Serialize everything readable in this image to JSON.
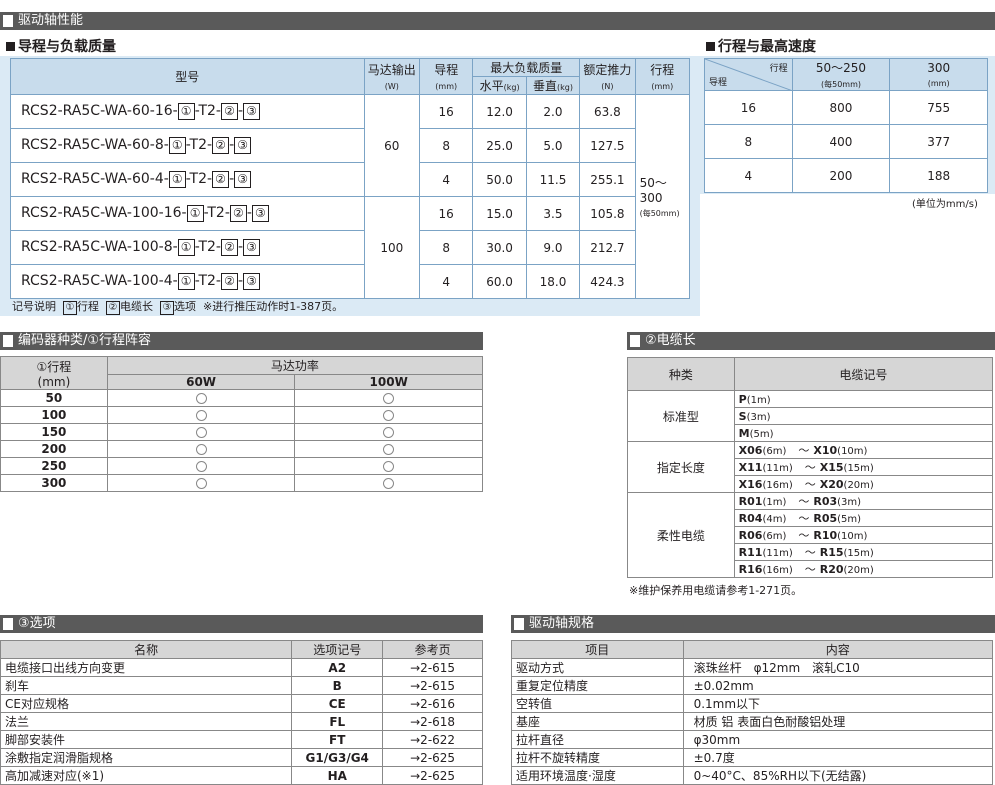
{
  "banner_top": "驱动轴性能",
  "section_lead": "导程与负载质量",
  "section_speed": "行程与最高速度",
  "lead_table": {
    "h_model": "型号",
    "h_motor": "马达输出",
    "h_motor_unit": "(W)",
    "h_lead": "导程",
    "h_lead_unit": "(mm)",
    "h_load": "最大负载质量",
    "h_horiz": "水平",
    "h_vert": "垂直",
    "h_kg": "(kg)",
    "h_thrust": "额定推力",
    "h_thrust_unit": "(N)",
    "h_stroke": "行程",
    "h_stroke_unit": "(mm)",
    "stroke": "50～300",
    "stroke_note": "(每50mm)",
    "motor_60": "60",
    "motor_100": "100",
    "code_1": "①",
    "code_2": "②",
    "code_3": "③",
    "code_t2": "-T2-",
    "rows": [
      {
        "model": "RCS2-RA5C-WA-60-16-",
        "lead": "16",
        "h": "12.0",
        "v": "2.0",
        "f": "63.8"
      },
      {
        "model": "RCS2-RA5C-WA-60-8-",
        "lead": "8",
        "h": "25.0",
        "v": "5.0",
        "f": "127.5"
      },
      {
        "model": "RCS2-RA5C-WA-60-4-",
        "lead": "4",
        "h": "50.0",
        "v": "11.5",
        "f": "255.1"
      },
      {
        "model": "RCS2-RA5C-WA-100-16-",
        "lead": "16",
        "h": "15.0",
        "v": "3.5",
        "f": "105.8"
      },
      {
        "model": "RCS2-RA5C-WA-100-8-",
        "lead": "8",
        "h": "30.0",
        "v": "9.0",
        "f": "212.7"
      },
      {
        "model": "RCS2-RA5C-WA-100-4-",
        "lead": "4",
        "h": "60.0",
        "v": "18.0",
        "f": "424.3"
      }
    ]
  },
  "legend": {
    "label": "记号说明",
    "i1": "行程",
    "i2": "电缆长",
    "i3": "选项",
    "note": "※进行推压动作时1-387页。"
  },
  "speed_table": {
    "h_stroke": "行程",
    "h_lead": "导程",
    "h_col1": "50～250",
    "h_col1_note": "(每50mm)",
    "h_col2": "300",
    "h_col2_note": "(mm)",
    "rows": [
      {
        "lead": "16",
        "a": "800",
        "b": "755"
      },
      {
        "lead": "8",
        "a": "400",
        "b": "377"
      },
      {
        "lead": "4",
        "a": "200",
        "b": "188"
      }
    ],
    "unit": "(单位为mm/s)"
  },
  "encoder": {
    "banner": "编码器种类/①行程阵容",
    "h_stroke": "①行程",
    "h_stroke_unit": "(mm)",
    "h_power": "马达功率",
    "h_60": "60W",
    "h_100": "100W",
    "rows": [
      "50",
      "100",
      "150",
      "200",
      "250",
      "300"
    ]
  },
  "cable": {
    "banner": "②电缆长",
    "h_type": "种类",
    "h_code": "电缆记号",
    "standard": "标准型",
    "specified": "指定长度",
    "flex": "柔性电缆",
    "tilde": "～",
    "std_rows": [
      {
        "c": "P",
        "l": "(1m)"
      },
      {
        "c": "S",
        "l": "(3m)"
      },
      {
        "c": "M",
        "l": "(5m)"
      }
    ],
    "spec_rows": [
      {
        "c1": "X06",
        "l1": "(6m)",
        "c2": "X10",
        "l2": "(10m)"
      },
      {
        "c1": "X11",
        "l1": "(11m)",
        "c2": "X15",
        "l2": "(15m)"
      },
      {
        "c1": "X16",
        "l1": "(16m)",
        "c2": "X20",
        "l2": "(20m)"
      }
    ],
    "flex_rows": [
      {
        "c1": "R01",
        "l1": "(1m)",
        "c2": "R03",
        "l2": "(3m)"
      },
      {
        "c1": "R04",
        "l1": "(4m)",
        "c2": "R05",
        "l2": "(5m)"
      },
      {
        "c1": "R06",
        "l1": "(6m)",
        "c2": "R10",
        "l2": "(10m)"
      },
      {
        "c1": "R11",
        "l1": "(11m)",
        "c2": "R15",
        "l2": "(15m)"
      },
      {
        "c1": "R16",
        "l1": "(16m)",
        "c2": "R20",
        "l2": "(20m)"
      }
    ],
    "note": "※维护保养用电缆请参考1-271页。"
  },
  "options": {
    "banner": "③选项",
    "h_name": "名称",
    "h_code": "选项记号",
    "h_page": "参考页",
    "rows": [
      {
        "name": "电缆接口出线方向变更",
        "code": "A2",
        "page": "→2-615"
      },
      {
        "name": "刹车",
        "code": "B",
        "page": "→2-615"
      },
      {
        "name": "CE对应规格",
        "code": "CE",
        "page": "→2-616"
      },
      {
        "name": "法兰",
        "code": "FL",
        "page": "→2-618"
      },
      {
        "name": "脚部安装件",
        "code": "FT",
        "page": "→2-622"
      },
      {
        "name": "涂敷指定润滑脂规格",
        "code": "G1/G3/G4",
        "page": "→2-625"
      },
      {
        "name": "高加减速对应(※1)",
        "code": "HA",
        "page": "→2-625"
      }
    ]
  },
  "spec": {
    "banner": "驱动轴规格",
    "h_item": "项目",
    "h_content": "内容",
    "rows": [
      {
        "item": "驱动方式",
        "content": "滚珠丝杆　φ12mm　滚轧C10"
      },
      {
        "item": "重复定位精度",
        "content": "±0.02mm"
      },
      {
        "item": "空转值",
        "content": "0.1mm以下"
      },
      {
        "item": "基座",
        "content": "材质 铝 表面白色耐酸铝处理"
      },
      {
        "item": "拉杆直径",
        "content": "φ30mm"
      },
      {
        "item": "拉杆不旋转精度",
        "content": "±0.7度"
      },
      {
        "item": "适用环境温度·湿度",
        "content": "0~40°C、85%RH以下(无结露)"
      }
    ]
  }
}
